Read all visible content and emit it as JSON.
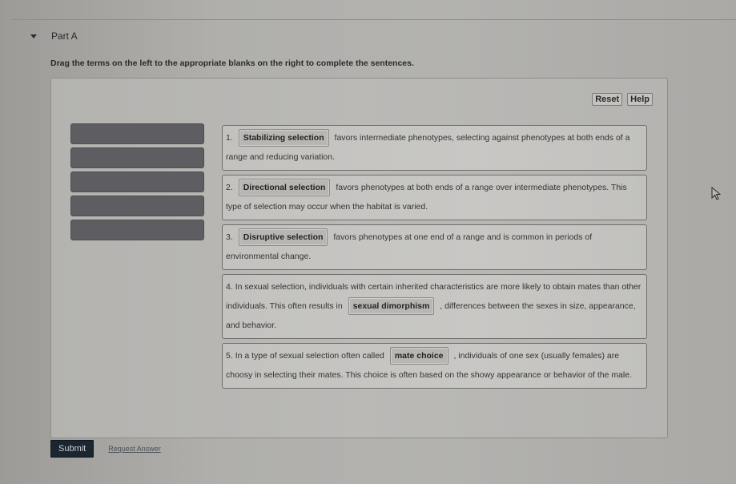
{
  "part": {
    "title": "Part A",
    "expanded": true
  },
  "instructions": "Drag the terms on the left to the appropriate blanks on the right to complete the sentences.",
  "panel": {
    "reset_label": "Reset",
    "help_label": "Help",
    "term_bank_empty_slots": 5
  },
  "sentences": [
    {
      "number": "1.",
      "before": "",
      "blank": "Stabilizing selection",
      "after": "favors intermediate phenotypes, selecting against phenotypes at both ends of a range and reducing variation."
    },
    {
      "number": "2.",
      "before": "",
      "blank": "Directional selection",
      "after": "favors phenotypes at both ends of a range over intermediate phenotypes. This type of selection may occur when the habitat is varied."
    },
    {
      "number": "3.",
      "before": "",
      "blank": "Disruptive selection",
      "after": "favors phenotypes at one end of a range and is common in periods of environmental change."
    },
    {
      "number": "4.",
      "before": "In sexual selection, individuals with certain inherited characteristics are more likely to obtain mates than other individuals. This often results in",
      "blank": "sexual dimorphism",
      "after": ", differences between the sexes in size, appearance, and behavior."
    },
    {
      "number": "5.",
      "before": "In a type of sexual selection often called",
      "blank": "mate choice",
      "after": ", individuals of one sex (usually females) are choosy in selecting their mates. This choice is often based on the showy appearance or behavior of the male."
    }
  ],
  "footer": {
    "submit_label": "Submit",
    "request_answer_label": "Request Answer"
  }
}
